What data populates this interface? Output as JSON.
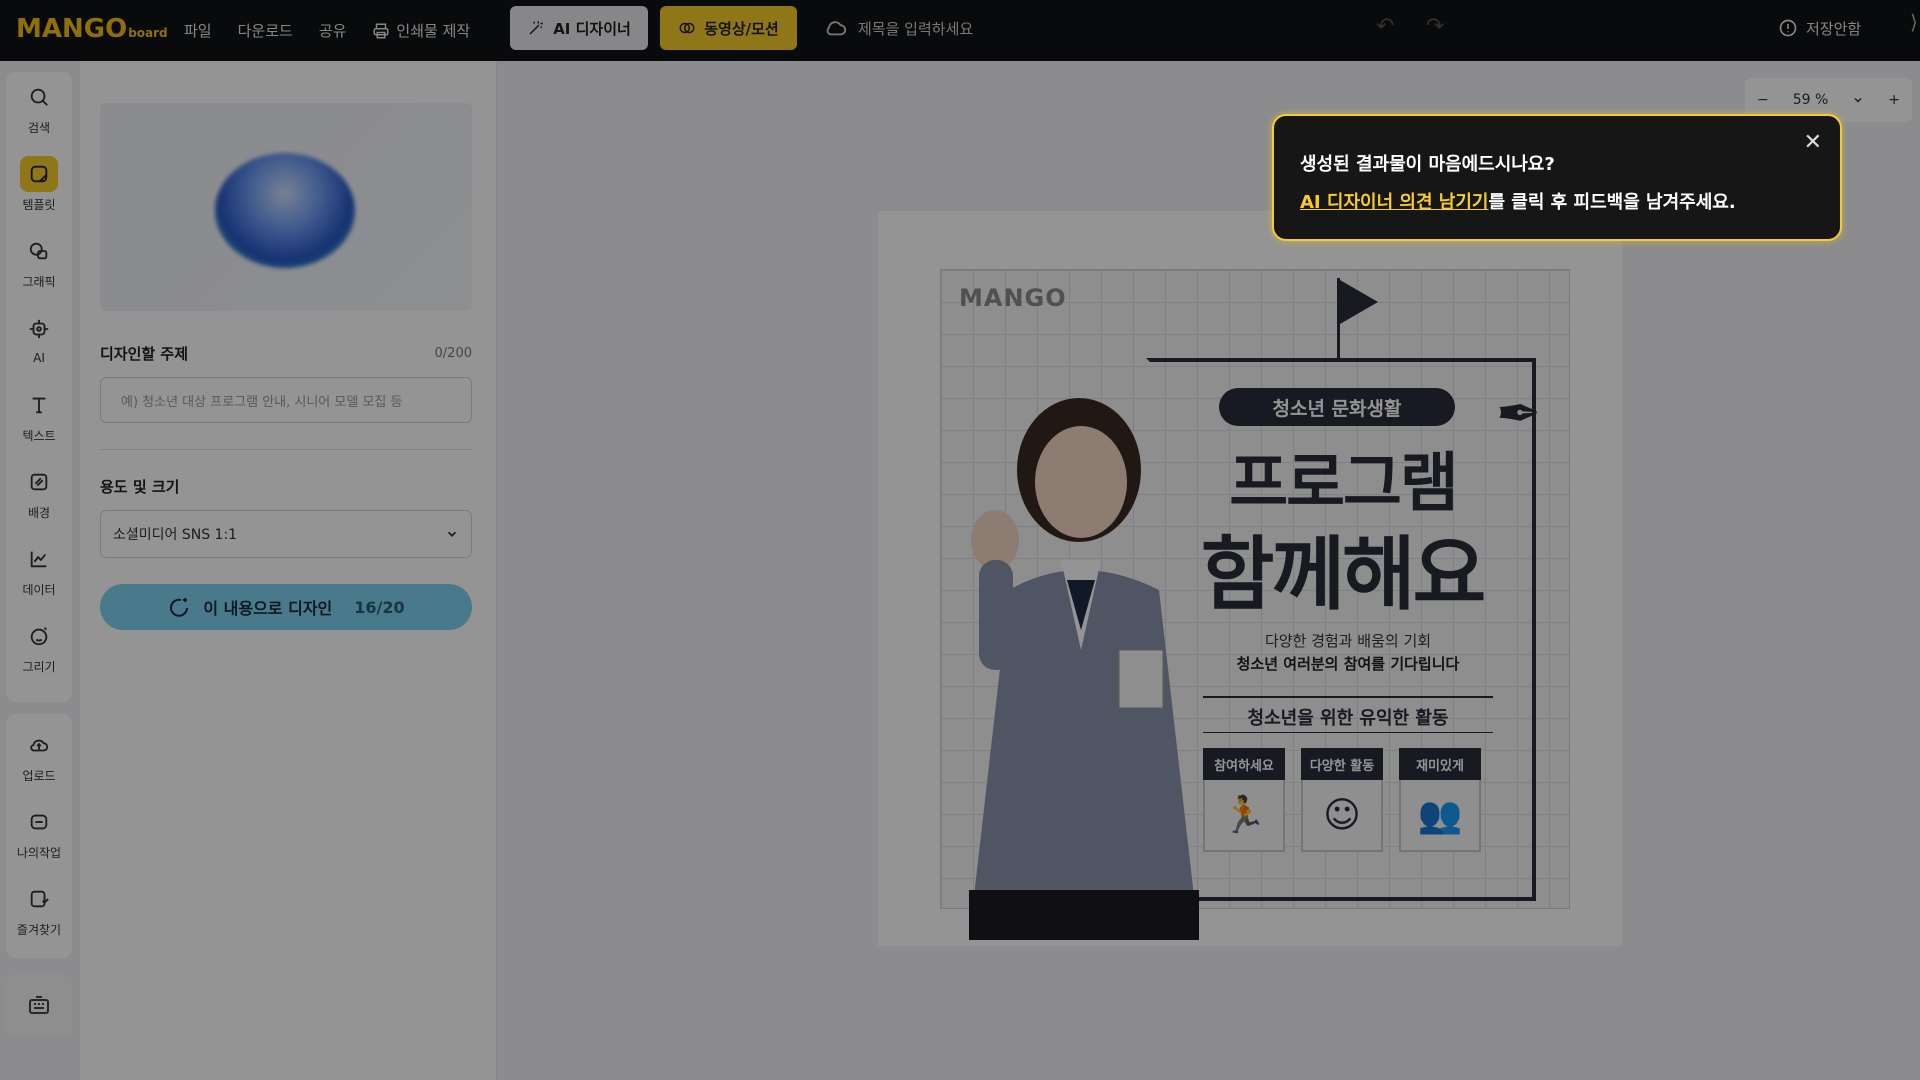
{
  "app": {
    "logo_main": "MANGO",
    "logo_sub": "board"
  },
  "menu": {
    "file": "파일",
    "download": "다운로드",
    "share": "공유",
    "print": "인쇄물 제작"
  },
  "toolbar": {
    "ai_designer": "AI 디자이너",
    "video_motion": "동영상/모션",
    "title_placeholder": "제목을 입력하세요",
    "unsaved": "저장안함"
  },
  "rail": {
    "items": [
      {
        "label": "검색",
        "icon": "search-icon"
      },
      {
        "label": "템플릿",
        "icon": "template-icon"
      },
      {
        "label": "그래픽",
        "icon": "graphic-icon"
      },
      {
        "label": "AI",
        "icon": "ai-chip-icon"
      },
      {
        "label": "텍스트",
        "icon": "text-icon"
      },
      {
        "label": "배경",
        "icon": "background-icon"
      },
      {
        "label": "데이터",
        "icon": "chart-icon"
      },
      {
        "label": "그리기",
        "icon": "draw-icon"
      }
    ],
    "items2": [
      {
        "label": "업로드",
        "icon": "upload-icon"
      },
      {
        "label": "나의작업",
        "icon": "my-work-icon"
      },
      {
        "label": "즐겨찾기",
        "icon": "favorite-icon"
      }
    ]
  },
  "panel": {
    "topic_label": "디자인할 주제",
    "topic_count": "0/200",
    "topic_placeholder": "예) 청소년 대상 프로그램 안내, 시니어 모델 모집 등",
    "size_label": "용도 및 크기",
    "size_value": "소셜미디어 SNS 1:1",
    "design_button": "이 내용으로 디자인",
    "design_quota": "16/20"
  },
  "zoom": {
    "value": "59 %"
  },
  "poster": {
    "logo": "MANGO",
    "pill": "청소년 문화생활",
    "headline1": "프로그램",
    "headline2": "함께해요",
    "sub1": "다양한 경험과 배움의 기회",
    "sub2": "청소년 여러분의 참여를 기다립니다",
    "activity": "청소년을 위한 유익한 활동",
    "tags": [
      "참여하세요",
      "다양한 활동",
      "재미있게"
    ]
  },
  "tooltip": {
    "line1": "생성된 결과물이 마음에드시나요?",
    "link": "AI 디자이너 의견 남기기",
    "line2_rest": "를 클릭 후 피드백을 남겨주세요."
  },
  "colors": {
    "accent": "#f7cc2a",
    "topbar": "#111214",
    "design_button": "#7fd3ef"
  }
}
